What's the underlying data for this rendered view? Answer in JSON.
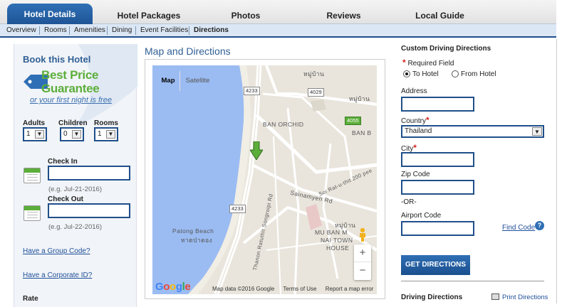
{
  "tabs": [
    "Hotel Details",
    "Hotel Packages",
    "Photos",
    "Reviews",
    "Local Guide"
  ],
  "subnav": [
    "Overview",
    "Rooms",
    "Amenities",
    "Dining",
    "Event Facilities",
    "Directions"
  ],
  "booking": {
    "title": "Book this Hotel",
    "bpg_line1": "Best Price",
    "bpg_line2": "Guarantee",
    "bpg_line3": "or your first night is free",
    "adults_label": "Adults",
    "adults_value": "1",
    "children_label": "Children",
    "children_value": "0",
    "rooms_label": "Rooms",
    "rooms_value": "1",
    "checkin_label": "Check In",
    "checkin_hint": "(e.g. Jul-21-2016)",
    "checkout_label": "Check Out",
    "checkout_hint": "(e.g. Jul-22-2016)",
    "group_code": "Have a Group Code?",
    "corporate_id": "Have a Corporate ID?",
    "rate_label": "Rate"
  },
  "map": {
    "title": "Map and Directions",
    "type_map": "Map",
    "type_satellite": "Satellite",
    "labels": {
      "thai1": "หมู่บ้าน",
      "thai2": "หมู่บ้าน",
      "ban_orchid": "BAN ORCHID",
      "ban_b": "BAN B",
      "patong": "Patong Beach",
      "patong_th": "หาดป่าตอง",
      "soi": "Soi Rat-u-thit 200 pee",
      "sainamyen": "Sainamyen Rd",
      "songroipi": "Thanon Ratuthit Songroipi Rd",
      "mu_ban": "MU BAN M",
      "nai_town": "NAI TOWN",
      "house": "HOUSE",
      "thai3": "หมู่บ้าน"
    },
    "shields": [
      "4233",
      "4029",
      "4055",
      "4233"
    ],
    "zoom_in": "+",
    "zoom_out": "−",
    "google": "Google",
    "footer": {
      "data": "Map data ©2016 Google",
      "terms": "Terms of Use",
      "report": "Report a map error"
    }
  },
  "form": {
    "title": "Custom Driving Directions",
    "required": "Required Field",
    "to_hotel": "To Hotel",
    "from_hotel": "From Hotel",
    "address": "Address",
    "country": "Country",
    "country_value": "Thailand",
    "city": "City",
    "zip": "Zip Code",
    "or": "-OR-",
    "airport": "Airport Code",
    "find_code": "Find Code",
    "button": "GET DIRECTIONS",
    "driving": "Driving Directions",
    "print": "Print Directions"
  },
  "colors": {
    "accent": "#1f5596",
    "green": "#5cae3a",
    "water": "#9bbcf2"
  },
  "icons": [
    "calendar-icon",
    "help-icon",
    "print-icon",
    "pegman-icon",
    "map-marker-icon",
    "tag-icon"
  ]
}
